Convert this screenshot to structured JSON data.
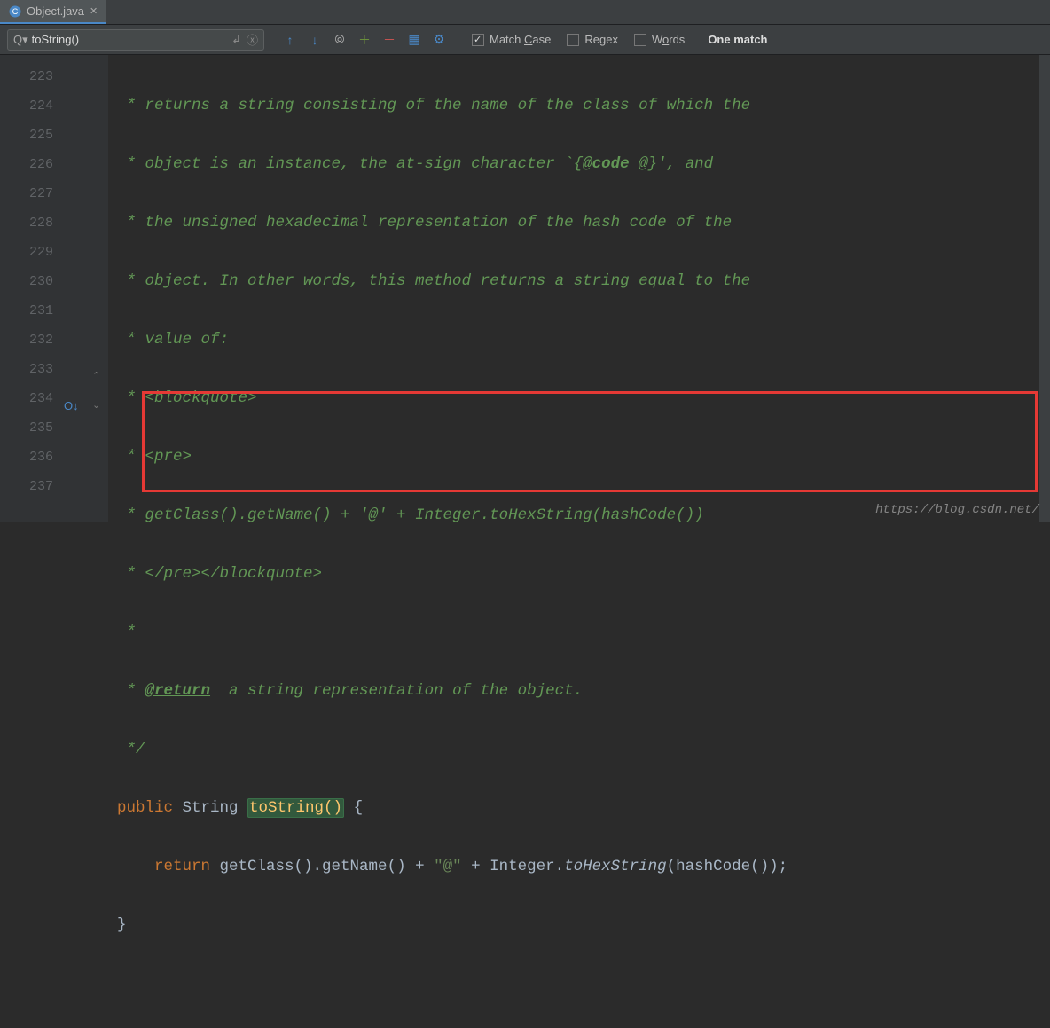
{
  "tab": {
    "filename": "Object.java"
  },
  "find": {
    "query": "toString()",
    "match_case": true,
    "regex": false,
    "words": false,
    "labels": {
      "match_case": "Match Case",
      "regex": "Regex",
      "words": "Words"
    },
    "result": "One match"
  },
  "gutter": {
    "start": 223,
    "end": 237
  },
  "code": {
    "l223": " * returns a string consisting of the name of the class of which the",
    "l224": " * object is an instance, the at-sign character `{",
    "l224b": " @}', and",
    "l224tag": "@code",
    "l225": " * the unsigned hexadecimal representation of the hash code of the",
    "l226": " * object. In other words, this method returns a string equal to the",
    "l227": " * value of:",
    "l228": " * <blockquote>",
    "l229": " * <pre>",
    "l230": " * getClass().getName() + '@' + Integer.toHexString(hashCode())",
    "l231": " * </pre></blockquote>",
    "l232": " *",
    "l233a": " * ",
    "l233tag": "@return",
    "l233b": "  a string representation of the object.",
    "l234": " */",
    "l235_public": "public",
    "l235_type": " String ",
    "l235_method": "toString()",
    "l235_brace": " {",
    "l236_return": "return",
    "l236_a": " getClass().getName() + ",
    "l236_str": "\"@\"",
    "l236_b": " + Integer.",
    "l236_hex": "toHexString",
    "l236_c": "(hashCode());",
    "l237": "}"
  },
  "watermark": "https://blog.csdn.net/"
}
